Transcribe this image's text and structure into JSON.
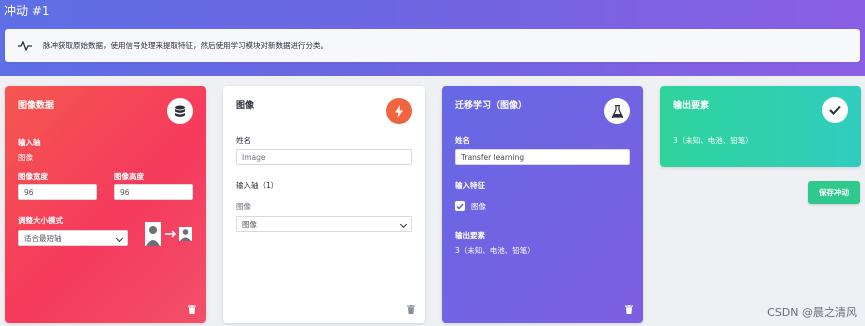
{
  "page": {
    "title": "冲动 #1"
  },
  "info": {
    "icon": "pulse-icon",
    "text": "脉冲获取原始数据，使用信号处理来提取特征，然后使用学习模块对新数据进行分类。"
  },
  "cards": {
    "image_data": {
      "title": "图像数据",
      "icon": "database-icon",
      "input_axis_label": "输入轴",
      "input_axis_value": "图像",
      "width_label": "图像宽度",
      "width_value": "96",
      "height_label": "图像高度",
      "height_value": "96",
      "resize_label": "调整大小模式",
      "resize_value": "适合最短轴"
    },
    "image": {
      "title": "图像",
      "icon": "bolt-icon",
      "name_label": "姓名",
      "name_value": "Image",
      "input_axes_label": "输入轴（1）",
      "axis_checkbox_label": "图像",
      "axis_select_value": "图像"
    },
    "transfer_learning": {
      "title": "迁移学习（图像）",
      "icon": "flask-icon",
      "name_label": "姓名",
      "name_value": "Transfer learning",
      "input_features_label": "输入特征",
      "feature_checkbox_label": "图像",
      "output_features_label": "输出要素",
      "output_features_value": "3（未知、电池、铅笔）"
    },
    "output_features": {
      "title": "输出要素",
      "icon": "check-icon",
      "value": "3（未知、电池、铅笔）"
    }
  },
  "save_button": "保存冲动",
  "watermark": "CSDN @晨之清风",
  "colors": {
    "header": "#6d66e2",
    "card_red": "#f53a5d",
    "card_purple": "#7064e3",
    "card_green": "#2fd39a",
    "badge_orange": "#f0653f"
  }
}
